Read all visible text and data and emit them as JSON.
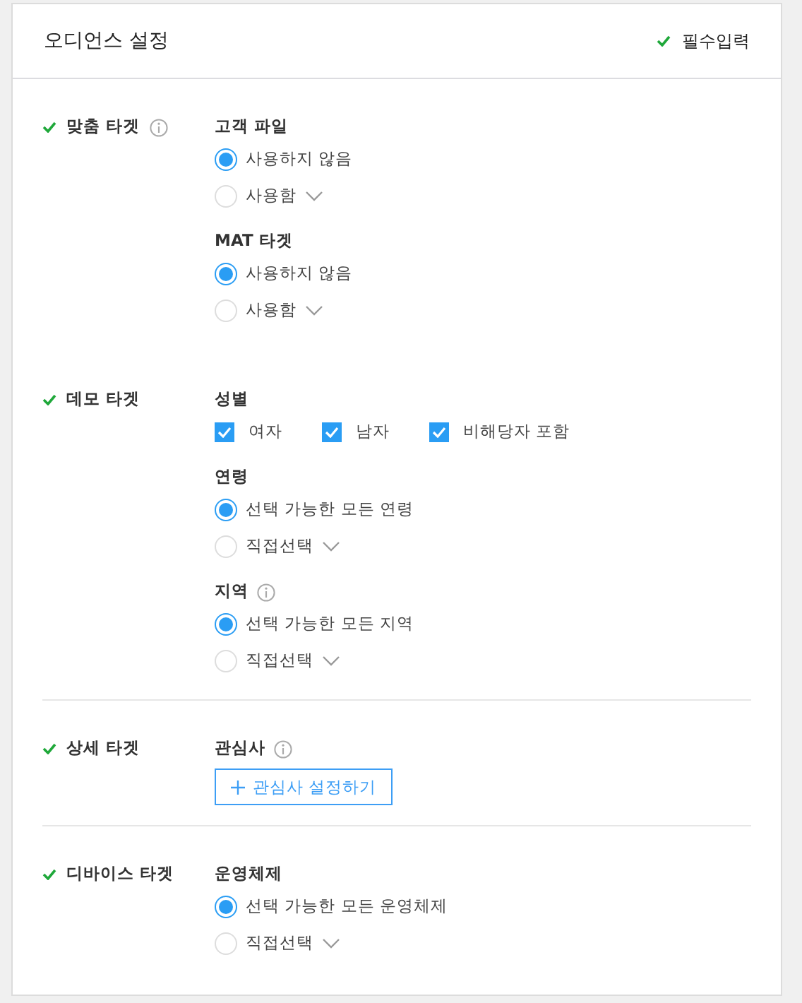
{
  "header": {
    "title": "오디언스 설정",
    "required_note": "필수입력"
  },
  "sections": [
    {
      "label": "맞춤 타겟",
      "info": true,
      "divider_above": false,
      "groups": [
        {
          "title": "고객 파일",
          "info": false,
          "kind": "radio",
          "options": [
            {
              "label": "사용하지 않음",
              "selected": true,
              "dropdown": false
            },
            {
              "label": "사용함",
              "selected": false,
              "dropdown": true
            }
          ]
        },
        {
          "title": "MAT 타겟",
          "info": false,
          "kind": "radio",
          "options": [
            {
              "label": "사용하지 않음",
              "selected": true,
              "dropdown": false
            },
            {
              "label": "사용함",
              "selected": false,
              "dropdown": true
            }
          ]
        }
      ]
    },
    {
      "label": "데모 타겟",
      "info": false,
      "divider_above": false,
      "groups": [
        {
          "title": "성별",
          "info": false,
          "kind": "checkbox",
          "options": [
            {
              "label": "여자",
              "checked": true
            },
            {
              "label": "남자",
              "checked": true
            },
            {
              "label": "비해당자 포함",
              "checked": true
            }
          ]
        },
        {
          "title": "연령",
          "info": false,
          "kind": "radio",
          "options": [
            {
              "label": "선택 가능한 모든 연령",
              "selected": true,
              "dropdown": false
            },
            {
              "label": "직접선택",
              "selected": false,
              "dropdown": true
            }
          ]
        },
        {
          "title": "지역",
          "info": true,
          "kind": "radio",
          "options": [
            {
              "label": "선택 가능한 모든 지역",
              "selected": true,
              "dropdown": false
            },
            {
              "label": "직접선택",
              "selected": false,
              "dropdown": true
            }
          ]
        }
      ]
    },
    {
      "label": "상세 타겟",
      "info": false,
      "divider_above": true,
      "groups": [
        {
          "title": "관심사",
          "info": true,
          "kind": "button",
          "button": "관심사 설정하기"
        }
      ]
    },
    {
      "label": "디바이스 타겟",
      "info": false,
      "divider_above": true,
      "groups": [
        {
          "title": "운영체제",
          "info": false,
          "kind": "radio",
          "options": [
            {
              "label": "선택 가능한 모든 운영체제",
              "selected": true,
              "dropdown": false
            },
            {
              "label": "직접선택",
              "selected": false,
              "dropdown": true
            }
          ]
        }
      ]
    }
  ]
}
